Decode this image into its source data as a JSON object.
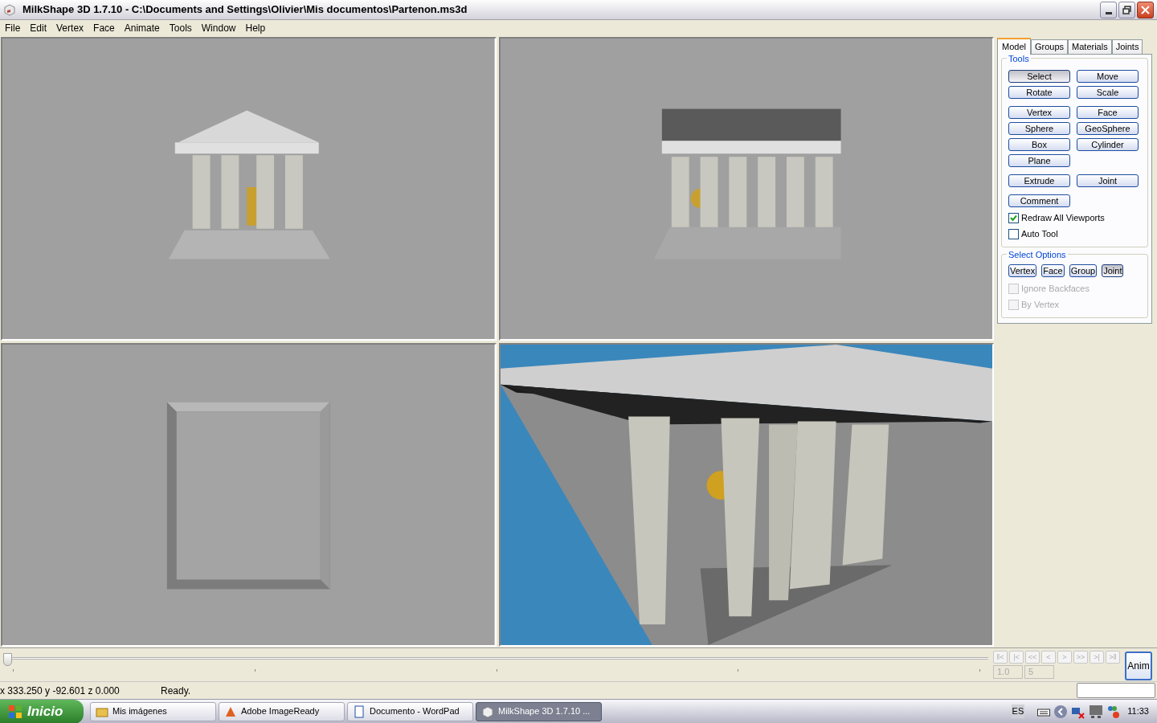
{
  "window": {
    "title": "MilkShape 3D 1.7.10 - C:\\Documents and Settings\\Olivier\\Mis documentos\\Partenon.ms3d"
  },
  "menu": [
    "File",
    "Edit",
    "Vertex",
    "Face",
    "Animate",
    "Tools",
    "Window",
    "Help"
  ],
  "panel": {
    "tabs": [
      {
        "label": "Model",
        "selected": true
      },
      {
        "label": "Groups",
        "selected": false
      },
      {
        "label": "Materials",
        "selected": false
      },
      {
        "label": "Joints",
        "selected": false
      }
    ],
    "tools": {
      "title": "Tools",
      "rows": [
        [
          {
            "label": "Select",
            "selected": true
          },
          {
            "label": "Move",
            "selected": false
          }
        ],
        [
          {
            "label": "Rotate",
            "selected": false
          },
          {
            "label": "Scale",
            "selected": false
          }
        ],
        [
          {
            "label": "Vertex",
            "selected": false
          },
          {
            "label": "Face",
            "selected": false
          }
        ],
        [
          {
            "label": "Sphere",
            "selected": false
          },
          {
            "label": "GeoSphere",
            "selected": false
          }
        ],
        [
          {
            "label": "Box",
            "selected": false
          },
          {
            "label": "Cylinder",
            "selected": false
          }
        ],
        [
          {
            "label": "Plane",
            "selected": false
          }
        ],
        [
          {
            "label": "Extrude",
            "selected": false
          },
          {
            "label": "Joint",
            "selected": false
          }
        ],
        [
          {
            "label": "Comment",
            "selected": false
          }
        ]
      ],
      "checkboxes": [
        {
          "label": "Redraw All Viewports",
          "checked": true
        },
        {
          "label": "Auto Tool",
          "checked": false
        }
      ]
    },
    "select_options": {
      "title": "Select Options",
      "buttons": [
        {
          "label": "Vertex",
          "selected": false
        },
        {
          "label": "Face",
          "selected": false
        },
        {
          "label": "Group",
          "selected": false
        },
        {
          "label": "Joint",
          "selected": true
        }
      ],
      "checkboxes": [
        {
          "label": "Ignore Backfaces",
          "checked": false,
          "disabled": true
        },
        {
          "label": "By Vertex",
          "checked": false,
          "disabled": true
        }
      ]
    }
  },
  "timeline": {
    "level": 0,
    "nav_buttons": [
      "‖<",
      "|<",
      "<<",
      "<",
      ">",
      ">>",
      ">|",
      ">‖"
    ],
    "nav_disabled": true,
    "frame": "1.0",
    "total_frames": "5",
    "anim_button": "Anim"
  },
  "status_bar": {
    "coordinates": "x 333.250 y -92.601 z 0.000",
    "message": "Ready."
  },
  "taskbar": {
    "start": "Inicio",
    "tasks": [
      {
        "label": "Mis imágenes",
        "selected": false
      },
      {
        "label": "Adobe ImageReady",
        "selected": false
      },
      {
        "label": "Documento - WordPad",
        "selected": false
      },
      {
        "label": "MilkShape 3D 1.7.10 ...",
        "selected": true
      }
    ],
    "language": "ES",
    "clock": "11:33"
  }
}
